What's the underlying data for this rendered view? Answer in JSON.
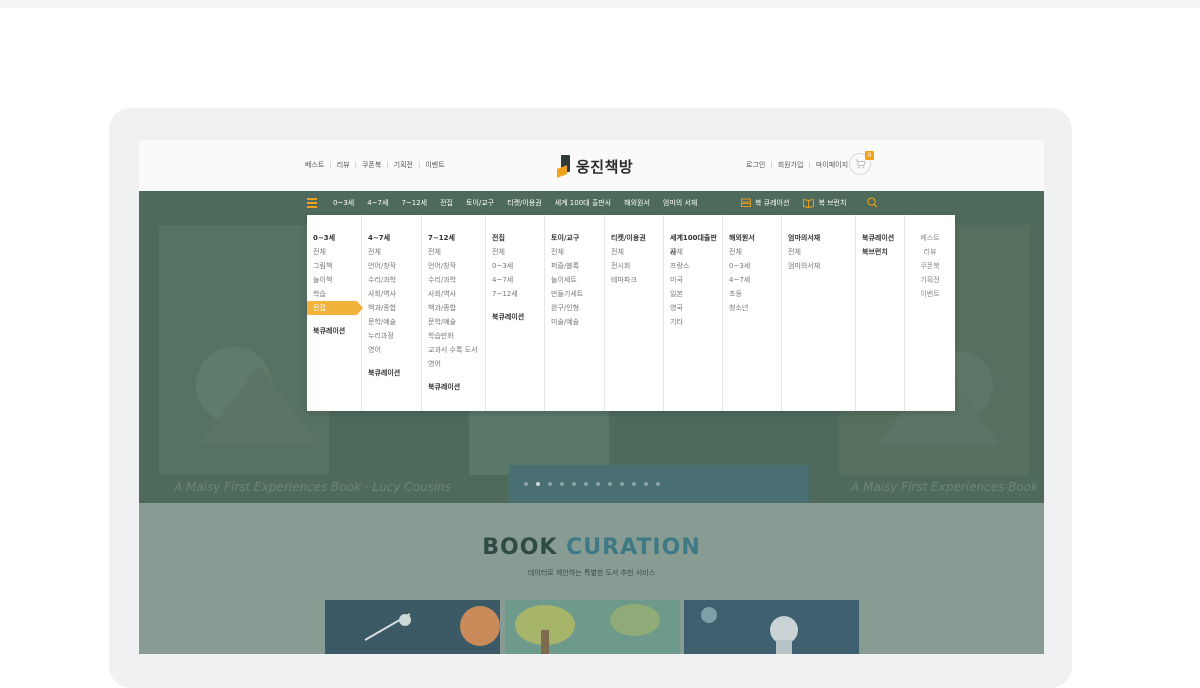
{
  "header": {
    "top_links": [
      "베스트",
      "리뷰",
      "쿠폰북",
      "기획전",
      "이벤트"
    ],
    "logo_text": "웅진책방",
    "account_links": [
      "로그인",
      "회원가입",
      "마이페이지"
    ],
    "cart_count": "0"
  },
  "nav": {
    "items": [
      "0~3세",
      "4~7세",
      "7~12세",
      "전집",
      "토이/교구",
      "티켓/이용권",
      "세계 100대 출판사",
      "해외원서",
      "엄마의 서재"
    ],
    "book_curation": "북 큐레이션",
    "book_brunch": "북 브런치"
  },
  "mega": {
    "col1": {
      "title": "0~3세",
      "items": [
        "전체",
        "그림책",
        "놀이책",
        "학습",
        "전집"
      ],
      "extra": "북큐레이션"
    },
    "col2": {
      "title": "4~7세",
      "items": [
        "전체",
        "언어/창작",
        "수리/과학",
        "사회/역사",
        "백과/종합",
        "문학/예술",
        "누리과정",
        "영어"
      ],
      "extra": "북큐레이션"
    },
    "col3": {
      "title": "7~12세",
      "items": [
        "전체",
        "언어/창작",
        "수리/과학",
        "사회/역사",
        "백과/종합",
        "문학/예술",
        "학습만화",
        "교과서 수록 도서",
        "영어"
      ],
      "extra": "북큐레이션"
    },
    "col4": {
      "title": "전집",
      "items": [
        "전체",
        "0~3세",
        "4~7세",
        "7~12세"
      ],
      "extra": "북큐레이션"
    },
    "col5": {
      "title": "토이/교구",
      "items": [
        "전체",
        "퍼즐/블록",
        "놀이세트",
        "만들기세트",
        "완구/인형",
        "미술/예술"
      ]
    },
    "col6": {
      "title": "티켓/이용권",
      "items": [
        "전체",
        "전시회",
        "테마파크"
      ]
    },
    "col7": {
      "title": "세계100대출판사",
      "items": [
        "전체",
        "프랑스",
        "미국",
        "일본",
        "영국",
        "기타"
      ]
    },
    "col8": {
      "title": "해외원서",
      "items": [
        "전체",
        "0~3세",
        "4~7세",
        "초등",
        "청소년"
      ]
    },
    "col9": {
      "title": "엄마의서재",
      "items": [
        "전체",
        "엄마의서재"
      ]
    },
    "col10": {
      "titles": [
        "북큐레이션",
        "북브런치"
      ]
    },
    "side": [
      "베스트",
      "리뷰",
      "쿠폰북",
      "기획전",
      "이벤트"
    ]
  },
  "hero": {
    "banner_left": "A Maisy First Experiences Book · Lucy Cousins",
    "banner_right": "A Maisy First Experiences Book"
  },
  "curation": {
    "title_a": "BOOK",
    "title_b": "CURATION",
    "subtitle": "데이터로 제안하는 특별한 도서 추천 서비스"
  },
  "colors": {
    "accent": "#f2a31b",
    "nav_green": "#4d6a5c",
    "curation_blue": "#3d7a86"
  }
}
